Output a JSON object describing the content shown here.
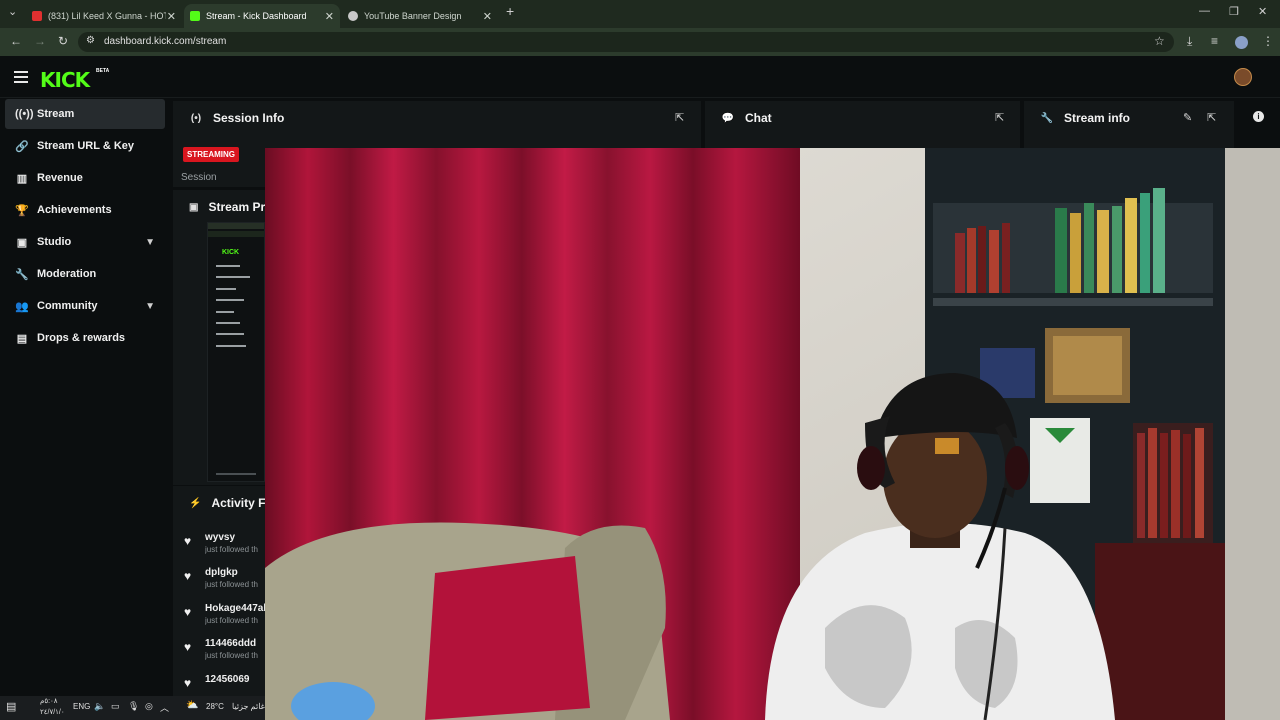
{
  "browser": {
    "tabs": [
      {
        "title": "(831) Lil Keed X Gunna - HOTT",
        "favicon_color": "#e03030"
      },
      {
        "title": "Stream - Kick Dashboard",
        "favicon_color": "#53fc18"
      },
      {
        "title": "YouTube Banner Design",
        "favicon_color": "#c8c8c8"
      }
    ],
    "url": "dashboard.kick.com/stream"
  },
  "header": {
    "logo": "KICK",
    "beta": "BETA"
  },
  "sidebar": {
    "items": [
      {
        "label": "Stream",
        "icon": "broadcast-icon"
      },
      {
        "label": "Stream URL & Key",
        "icon": "link-icon"
      },
      {
        "label": "Revenue",
        "icon": "chart-icon"
      },
      {
        "label": "Achievements",
        "icon": "trophy-icon"
      },
      {
        "label": "Studio",
        "icon": "studio-icon"
      },
      {
        "label": "Moderation",
        "icon": "wrench-icon"
      },
      {
        "label": "Community",
        "icon": "users-icon"
      },
      {
        "label": "Drops & rewards",
        "icon": "drops-icon"
      }
    ]
  },
  "panels": {
    "session_info": {
      "title": "Session Info",
      "badge": "STREAMING",
      "session_label": "Session"
    },
    "chat": {
      "title": "Chat"
    },
    "stream_info": {
      "title": "Stream info"
    },
    "stream_preview": {
      "title": "Stream Pr"
    },
    "activity": {
      "title": "Activity F",
      "items": [
        {
          "user": "wyvsy",
          "text": "just followed th"
        },
        {
          "user": "dplgkp",
          "text": "just followed th"
        },
        {
          "user": "Hokage447al",
          "text": "just followed th"
        },
        {
          "user": "114466ddd",
          "text": "just followed th"
        },
        {
          "user": "12456069",
          "text": ""
        }
      ]
    }
  },
  "taskbar": {
    "time": "٥:٠٨م",
    "date": "٢٤/٧/١/٠",
    "lang": "ENG",
    "temp": "28°C",
    "weather": "غائم جزئيا"
  }
}
